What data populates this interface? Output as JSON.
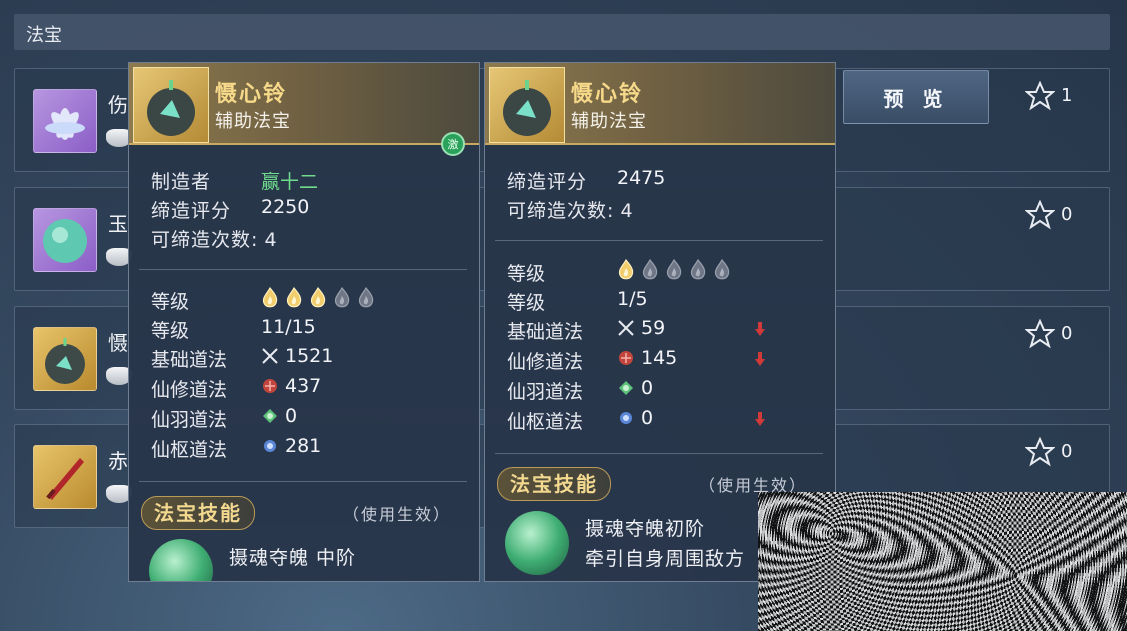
{
  "header": {
    "title": "法宝"
  },
  "list": [
    {
      "name": "伤",
      "icon": "lotus-icon",
      "stars": "1"
    },
    {
      "name": "玉",
      "icon": "jade-orb-icon",
      "stars": "0"
    },
    {
      "name": "慑",
      "icon": "bell-orb-icon",
      "stars": "0"
    },
    {
      "name": "赤",
      "icon": "red-sword-icon",
      "stars": "0"
    }
  ],
  "preview_button": "预 览",
  "tooltip_left": {
    "name": "慑心铃",
    "type": "辅助法宝",
    "badge": "激",
    "maker_label": "制造者",
    "maker_value": "赢十二",
    "score_label": "缔造评分",
    "score_value": "2250",
    "times_label": "可缔造次数:",
    "times_value": "4",
    "level_label": "等级",
    "level_label2": "等级",
    "level_value": "11/15",
    "level_flames_filled": 3,
    "level_flames_total": 5,
    "stats": [
      {
        "label": "基础道法",
        "icon": "crossed-swords-icon",
        "value": "1521"
      },
      {
        "label": "仙修道法",
        "icon": "red-emblem-icon",
        "value": "437"
      },
      {
        "label": "仙羽道法",
        "icon": "green-feather-icon",
        "value": "0"
      },
      {
        "label": "仙枢道法",
        "icon": "blue-lotus-icon",
        "value": "281"
      }
    ],
    "skill_header": "法宝技能",
    "skill_note": "（使用生效）",
    "skill_name": "摄魂夺魄 中阶"
  },
  "tooltip_right": {
    "name": "慑心铃",
    "type": "辅助法宝",
    "score_label": "缔造评分",
    "score_value": "2475",
    "times_label": "可缔造次数:",
    "times_value": "4",
    "level_label": "等级",
    "level_label2": "等级",
    "level_value": "1/5",
    "level_flames_filled": 1,
    "level_flames_total": 5,
    "stats": [
      {
        "label": "基础道法",
        "icon": "crossed-swords-icon",
        "value": "59",
        "down": true
      },
      {
        "label": "仙修道法",
        "icon": "red-emblem-icon",
        "value": "145",
        "down": true
      },
      {
        "label": "仙羽道法",
        "icon": "green-feather-icon",
        "value": "0",
        "down": false
      },
      {
        "label": "仙枢道法",
        "icon": "blue-lotus-icon",
        "value": "0",
        "down": true
      }
    ],
    "skill_header": "法宝技能",
    "skill_note": "（使用生效）",
    "skill_name": "摄魂夺魄初阶",
    "skill_desc": "牵引自身周围敌方"
  },
  "colors": {
    "gold": "#c9a860",
    "green": "#6fdc8c",
    "down_arrow": "#d23a3a"
  }
}
